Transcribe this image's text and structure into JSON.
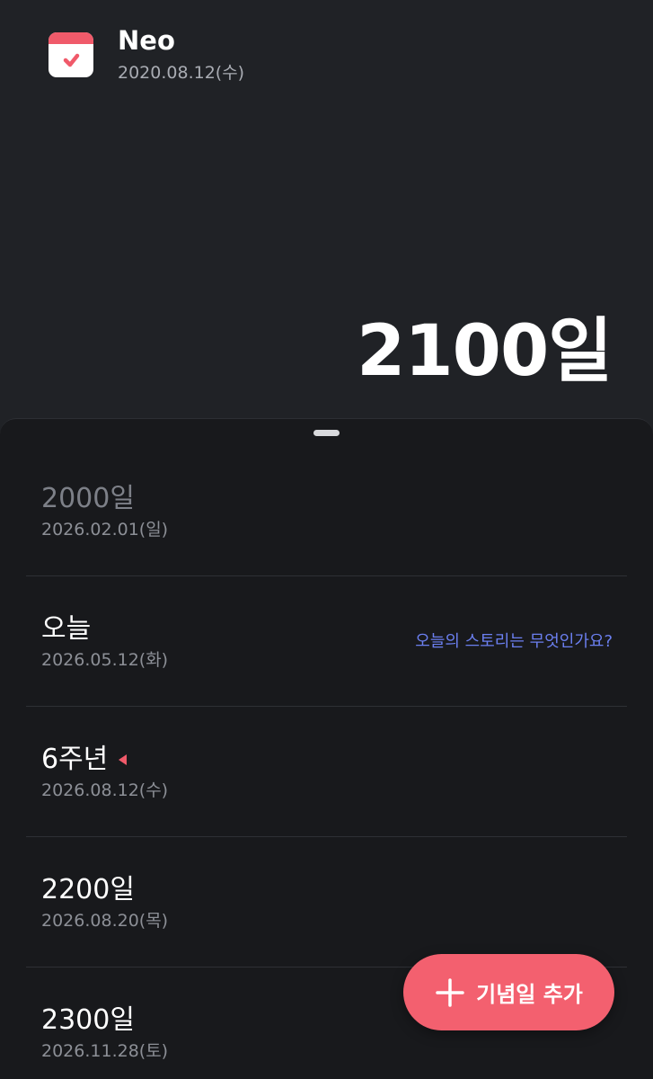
{
  "header": {
    "name": "Neo",
    "start_date": "2020.08.12(수)",
    "day_count": "2100일"
  },
  "anniversaries": [
    {
      "title": "2000일",
      "date": "2026.02.01(일)",
      "past": true
    },
    {
      "title": "오늘",
      "date": "2026.05.12(화)",
      "link": "오늘의 스토리는 무엇인가요?"
    },
    {
      "title": "6주년",
      "date": "2026.08.12(수)",
      "marker": "red-pointer"
    },
    {
      "title": "2200일",
      "date": "2026.08.20(목)"
    },
    {
      "title": "2300일",
      "date": "2026.11.28(토)"
    }
  ],
  "fab": {
    "label": "기념일 추가"
  },
  "colors": {
    "accent": "#f3606f",
    "link": "#6b7ff0",
    "background": "#202226",
    "sheet": "#18191c"
  }
}
